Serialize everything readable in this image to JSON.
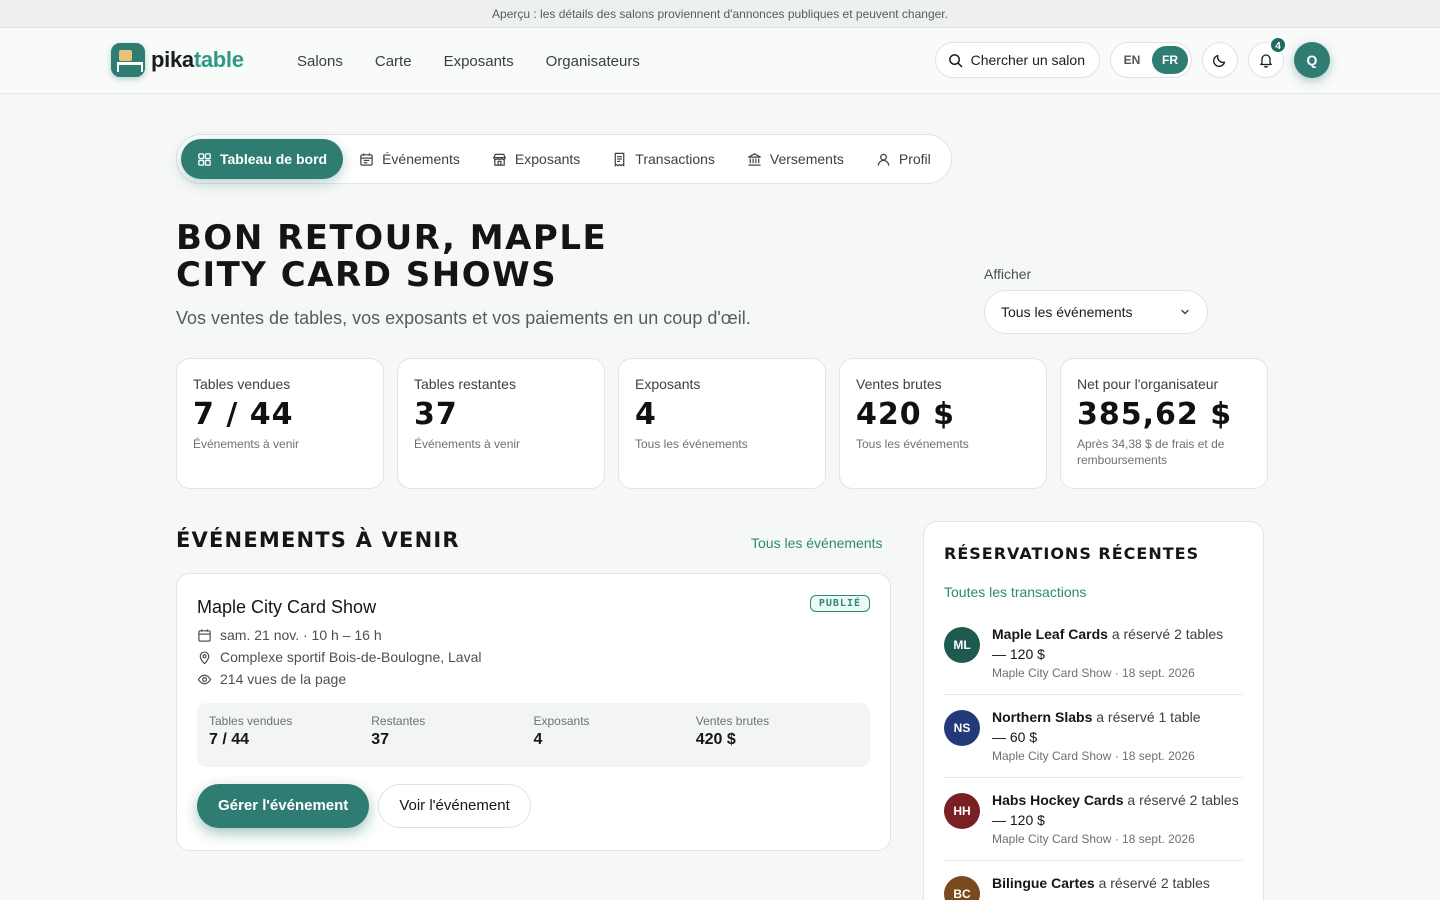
{
  "notice": "Aperçu : les détails des salons proviennent d'annonces publiques et peuvent changer.",
  "brand": {
    "part1": "pika",
    "part2": "table"
  },
  "nav": [
    {
      "label": "Salons"
    },
    {
      "label": "Carte"
    },
    {
      "label": "Exposants"
    },
    {
      "label": "Organisateurs"
    }
  ],
  "search_label": "Chercher un salon",
  "lang": {
    "en": "EN",
    "fr": "FR",
    "active": "FR"
  },
  "notifications_count": "4",
  "user_initial": "Q",
  "tabs": [
    {
      "label": "Tableau de bord",
      "icon": "dashboard-icon",
      "active": true
    },
    {
      "label": "Événements",
      "icon": "calendar-icon"
    },
    {
      "label": "Exposants",
      "icon": "store-icon"
    },
    {
      "label": "Transactions",
      "icon": "receipt-icon"
    },
    {
      "label": "Versements",
      "icon": "bank-icon"
    },
    {
      "label": "Profil",
      "icon": "user-icon"
    }
  ],
  "hero": {
    "line1": "BON RETOUR, MAPLE",
    "line2": "CITY CARD SHOWS",
    "subtitle": "Vos ventes de tables, vos exposants et vos paiements en un coup d'œil."
  },
  "filter": {
    "label": "Afficher",
    "value": "Tous les événements"
  },
  "stats": [
    {
      "label": "Tables vendues",
      "value": "7 / 44",
      "sub": "Événements à venir"
    },
    {
      "label": "Tables restantes",
      "value": "37",
      "sub": "Événements à venir"
    },
    {
      "label": "Exposants",
      "value": "4",
      "sub": "Tous les événements"
    },
    {
      "label": "Ventes brutes",
      "value": "420 $",
      "sub": "Tous les événements"
    },
    {
      "label": "Net pour l'organisateur",
      "value": "385,62 $",
      "sub": "Après 34,38 $ de frais et de remboursements"
    }
  ],
  "upcoming": {
    "title": "ÉVÉNEMENTS À VENIR",
    "link": "Tous les événements",
    "event": {
      "title": "Maple City Card Show",
      "status": "PUBLIÉ",
      "date": "sam. 21 nov. · 10 h – 16 h",
      "location": "Complexe sportif Bois-de-Boulogne, Laval",
      "views": "214 vues de la page",
      "stats": [
        {
          "label": "Tables vendues",
          "value": "7 / 44"
        },
        {
          "label": "Restantes",
          "value": "37"
        },
        {
          "label": "Exposants",
          "value": "4"
        },
        {
          "label": "Ventes brutes",
          "value": "420 $"
        }
      ],
      "manage": "Gérer l'événement",
      "view": "Voir l'événement"
    }
  },
  "reservations": {
    "title": "RÉSERVATIONS RÉCENTES",
    "link": "Toutes les transactions",
    "items": [
      {
        "initials": "ML",
        "name": "Maple Leaf Cards",
        "action": " a réservé 2 tables",
        "amount": "— 120 $",
        "meta": "Maple City Card Show · 18 sept. 2026",
        "color": "#1f5a4f"
      },
      {
        "initials": "NS",
        "name": "Northern Slabs",
        "action": " a réservé 1 table",
        "amount": "— 60 $",
        "meta": "Maple City Card Show · 18 sept. 2026",
        "color": "#233a7a"
      },
      {
        "initials": "HH",
        "name": "Habs Hockey Cards",
        "action": " a réservé 2 tables",
        "amount": "— 120 $",
        "meta": "Maple City Card Show · 18 sept. 2026",
        "color": "#7a1f24"
      },
      {
        "initials": "BC",
        "name": "Bilingue Cartes",
        "action": " a réservé 2 tables",
        "amount": "",
        "meta": "",
        "color": "#7a4a1f"
      }
    ]
  },
  "colors": {
    "accent": "#2f7d72",
    "link": "#2a8a77",
    "background": "#f6f7f7"
  }
}
